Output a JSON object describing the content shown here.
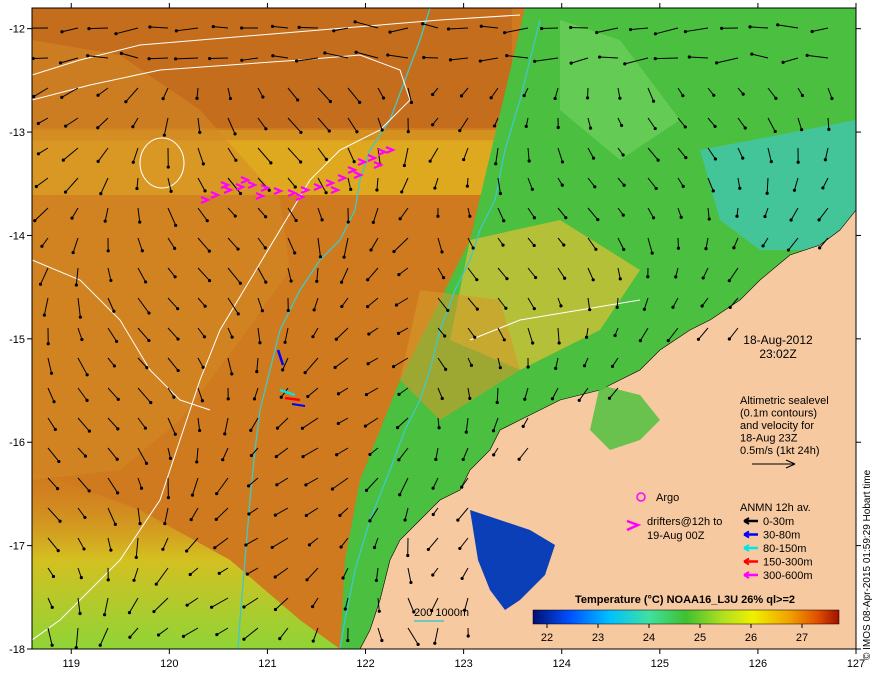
{
  "map": {
    "y_ticks": [
      "-12",
      "-13",
      "-14",
      "-15",
      "-16",
      "-17",
      "-18"
    ],
    "x_ticks": [
      "119",
      "120",
      "121",
      "122",
      "123",
      "124",
      "125",
      "126",
      "127"
    ],
    "lon_range": [
      118.6,
      127.0
    ],
    "lat_range": [
      -18.0,
      -11.8
    ]
  },
  "info": {
    "date": "18-Aug-2012",
    "time": "23:02Z",
    "sealevel_lines": [
      "Altimetric sealevel",
      "(0.1m contours)",
      "and velocity for",
      "18-Aug 23Z",
      "0.5m/s (1kt 24h)"
    ]
  },
  "legend": {
    "argo_label": "Argo",
    "drifters_lines": [
      "drifters@12h to",
      "19-Aug 00Z"
    ],
    "anmn_title": "ANMN 12h av.",
    "anmn_items": [
      {
        "label": "0-30m",
        "color": "#000000"
      },
      {
        "label": "30-80m",
        "color": "#0000ff"
      },
      {
        "label": "80-150m",
        "color": "#00e5e5"
      },
      {
        "label": "150-300m",
        "color": "#ff0000"
      },
      {
        "label": "300-600m",
        "color": "#ff00ff"
      }
    ],
    "isobath_label": "200  1000m"
  },
  "colorbar": {
    "title": "Temperature (°C) NOAA16_L3U 26% ql>=2",
    "ticks": [
      "22",
      "23",
      "24",
      "25",
      "26",
      "27"
    ]
  },
  "credit": "© IMOS 08-Apr-2015 01:59:29 Hobart time",
  "colors": {
    "land": "#f7c9a0",
    "warm": "#cf7a1e",
    "cool": "#4bbf3f",
    "isobath": "#40c8c8"
  }
}
